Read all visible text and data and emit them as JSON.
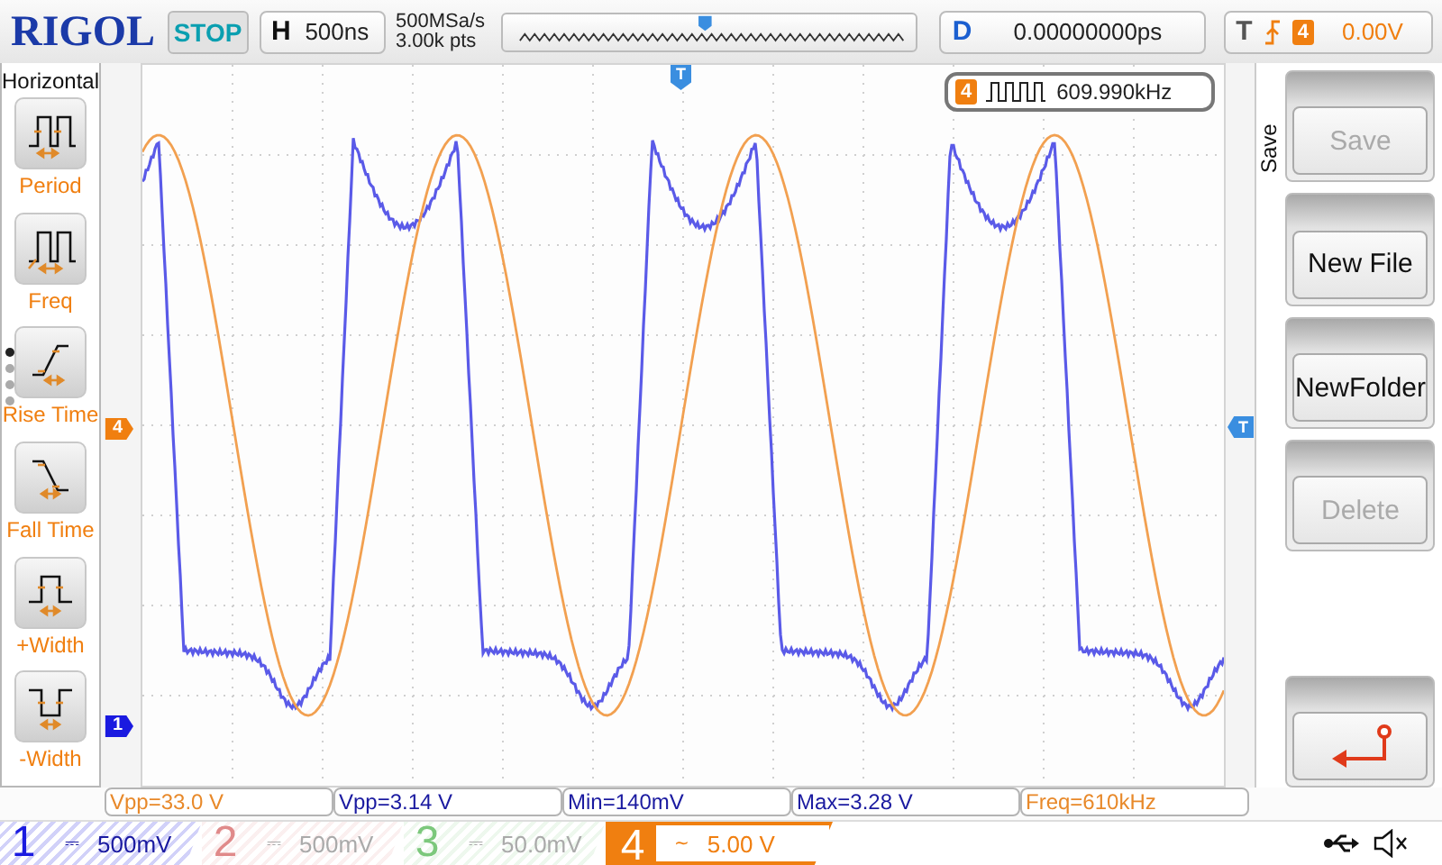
{
  "header": {
    "logo": "RIGOL",
    "run_state": "STOP",
    "timebase": {
      "label": "H",
      "value": "500ns"
    },
    "sample_rate": "500MSa/s",
    "memory_depth": "3.00k pts",
    "delay": {
      "label": "D",
      "value": "0.00000000ps"
    },
    "trigger": {
      "label": "T",
      "source": "4",
      "level": "0.00V"
    }
  },
  "measure_menu": {
    "title": "Horizontal",
    "items": [
      {
        "label": "Period",
        "kind": "period"
      },
      {
        "label": "Freq",
        "kind": "freq"
      },
      {
        "label": "Rise Time",
        "kind": "rise"
      },
      {
        "label": "Fall Time",
        "kind": "fall"
      },
      {
        "label": "+Width",
        "kind": "pwidth"
      },
      {
        "label": "-Width",
        "kind": "nwidth"
      }
    ],
    "pages": [
      {
        "selected": true
      },
      {
        "selected": false
      },
      {
        "selected": false
      },
      {
        "selected": false
      }
    ]
  },
  "markers": {
    "trigger_position": "T",
    "channel_4": "4",
    "channel_1": "1",
    "trigger_level": "T"
  },
  "counter": {
    "channel": "4",
    "value": "609.990kHz"
  },
  "measurements": [
    {
      "text": "Vpp=33.0 V",
      "color": "#e8892a"
    },
    {
      "text": "Vpp=3.14 V",
      "color": "#1a1aa0"
    },
    {
      "text": "Min=140mV",
      "color": "#1a1aa0"
    },
    {
      "text": "Max=3.28 V",
      "color": "#1a1aa0"
    },
    {
      "text": "Freq=610kHz",
      "color": "#e8892a"
    }
  ],
  "softkeys": {
    "menu": "Save",
    "keys": [
      {
        "kind": "text",
        "label": "Save",
        "disabled": true
      },
      {
        "kind": "text",
        "label": "New File",
        "disabled": false
      },
      {
        "kind": "text",
        "label": "NewFolder",
        "disabled": false
      },
      {
        "kind": "text",
        "label": "Delete",
        "disabled": true
      },
      {
        "kind": "return",
        "disabled": false
      }
    ]
  },
  "channels": [
    {
      "number": "1",
      "coupling": "⎓",
      "scale": "500mV",
      "on": true,
      "selected": false,
      "color": "#1a1ae0"
    },
    {
      "number": "2",
      "coupling": "⎓",
      "scale": "500mV",
      "on": false,
      "selected": false,
      "color": "#e08a8a"
    },
    {
      "number": "3",
      "coupling": "⎓",
      "scale": "50.0mV",
      "on": false,
      "selected": false,
      "color": "#7cc87c"
    },
    {
      "number": "4",
      "coupling": "~",
      "scale": "5.00 V",
      "on": true,
      "selected": true,
      "color": "#f07f10"
    }
  ]
}
